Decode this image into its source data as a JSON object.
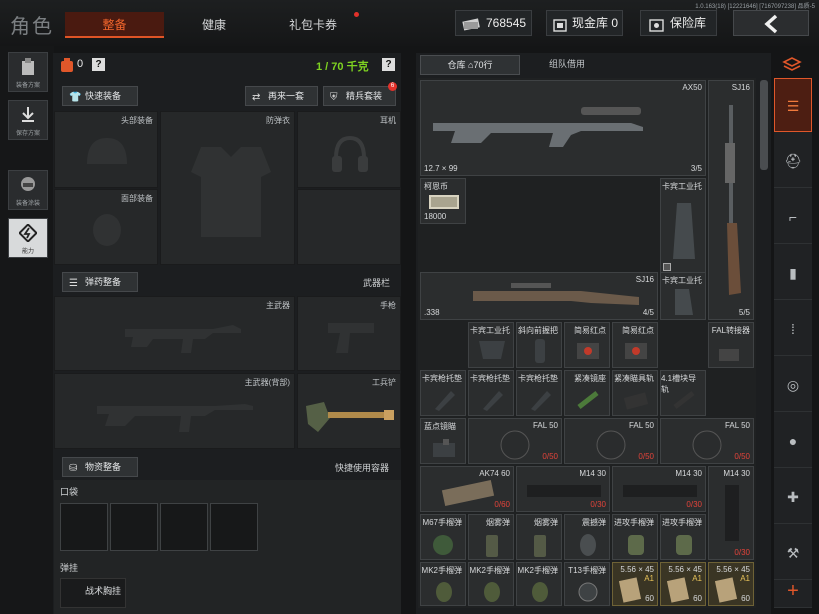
{
  "app": {
    "title": "角色",
    "version": "1.0.163(18) [12221646] [7167097238] 品质-5"
  },
  "tabs": [
    {
      "label": "整备",
      "active": true
    },
    {
      "label": "健康",
      "active": false
    },
    {
      "label": "礼包卡券",
      "active": false
    }
  ],
  "stats": {
    "money": "768545",
    "cash_label": "现金库 0",
    "vault_label": "保险库"
  },
  "left_nav": [
    {
      "label": "装备方案",
      "icon": "plan-icon"
    },
    {
      "label": "保存方案",
      "icon": "save-icon"
    },
    {
      "label": "装备涂装",
      "icon": "paint-icon"
    },
    {
      "label": "能力",
      "icon": "ability-icon"
    }
  ],
  "loadout": {
    "count": "0",
    "help": "?",
    "weight": "1 / 70 千克",
    "quick_equip": "快速装备",
    "repeat": "再来一套",
    "elite": "精兵套装",
    "elite_badge": "6",
    "slots": {
      "head": "头部装备",
      "armor": "防弹衣",
      "ear": "耳机",
      "face": "面部装备"
    },
    "ammo_section": "弹药整备",
    "weapon_bar": "武器栏",
    "weapons": {
      "primary": "主武器",
      "pistol": "手枪",
      "primary_back": "主武器(背部)",
      "shovel": "工兵铲"
    },
    "supply_section": "物资整备",
    "quick_container": "快捷使用容器",
    "pocket": "口袋",
    "hang": "弹挂",
    "chest_rig": "战术胸挂"
  },
  "warehouse": {
    "tab_store": "仓库",
    "rows": "70行",
    "tab_team": "组队借用",
    "items": {
      "ax50": {
        "name": "AX50",
        "ammo": "12.7 × 99",
        "count": "3/5"
      },
      "sj16_tall": {
        "name": "SJ16",
        "count": "5/5"
      },
      "cash": {
        "name": "柯恩币",
        "value": "18000"
      },
      "stock1": {
        "name": "卡宾工业托"
      },
      "sj16": {
        "name": "SJ16",
        "ammo": ".338",
        "count": "4/5"
      },
      "stock2": {
        "name": "卡宾工业托"
      },
      "stock3": {
        "name": "卡宾工业托"
      },
      "grip": {
        "name": "斜向前握把"
      },
      "reddot1": {
        "name": "简易红点"
      },
      "reddot2": {
        "name": "简易红点"
      },
      "fal_adapter": {
        "name": "FAL转接器"
      },
      "buttpad1": {
        "name": "卡宾枪托垫"
      },
      "buttpad2": {
        "name": "卡宾枪托垫"
      },
      "buttpad3": {
        "name": "卡宾枪托垫"
      },
      "scope_mount": {
        "name": "紧凑镜座"
      },
      "rail": {
        "name": "紧凑瞄具轨"
      },
      "mini_rail": {
        "name": "4.1槽块导轨"
      },
      "blue_sight": {
        "name": "蓝点镜瞄"
      },
      "fal1": {
        "name": "FAL 50",
        "count": "0/50"
      },
      "fal2": {
        "name": "FAL 50",
        "count": "0/50"
      },
      "fal3": {
        "name": "FAL 50",
        "count": "0/50"
      },
      "ak74": {
        "name": "AK74 60",
        "count": "0/60"
      },
      "m14a": {
        "name": "M14 30",
        "count": "0/30"
      },
      "m14b": {
        "name": "M14 30",
        "count": "0/30"
      },
      "m14c": {
        "name": "M14 30",
        "count": "0/30"
      },
      "m67": {
        "name": "M67手榴弹"
      },
      "smoke1": {
        "name": "烟雾弹"
      },
      "smoke2": {
        "name": "烟雾弹"
      },
      "tear": {
        "name": "震撼弹"
      },
      "incend1": {
        "name": "进攻手榴弹"
      },
      "incend2": {
        "name": "进攻手榴弹"
      },
      "mk2a": {
        "name": "MK2手榴弹"
      },
      "mk2b": {
        "name": "MK2手榴弹"
      },
      "mk2c": {
        "name": "MK2手榴弹"
      },
      "t13": {
        "name": "T13手榴弹"
      },
      "ammo1": {
        "name": "5.56 × 45",
        "grade": "A1",
        "count": "60"
      },
      "ammo2": {
        "name": "5.56 × 45",
        "grade": "A1",
        "count": "60"
      },
      "ammo3": {
        "name": "5.56 × 45",
        "grade": "A1",
        "count": "60"
      }
    }
  },
  "right_nav": [
    "all-icon",
    "helmet-icon",
    "rifle-icon",
    "magazine-icon",
    "ammo-icon",
    "scope-icon",
    "grenade-icon",
    "medical-icon",
    "tool-icon",
    "add-icon"
  ],
  "colors": {
    "accent": "#e05426",
    "weight": "#7ed321",
    "red": "#e2433a"
  }
}
